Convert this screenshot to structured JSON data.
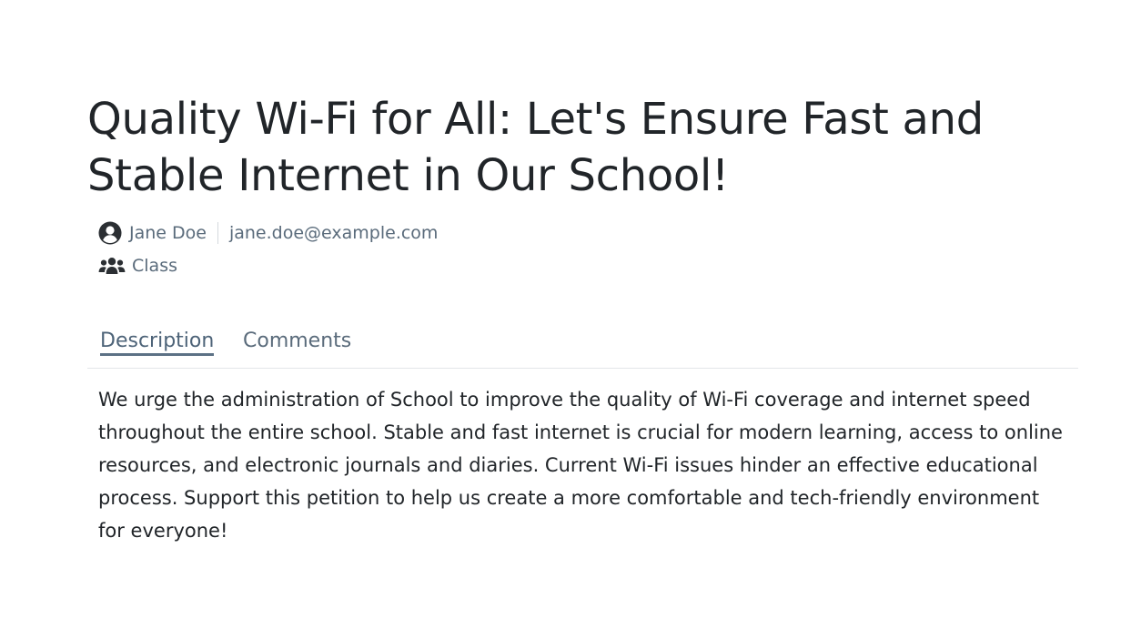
{
  "petition": {
    "title": "Quality Wi-Fi for All: Let's Ensure Fast and Stable Internet in Our School!",
    "author_name": "Jane Doe",
    "author_email": "jane.doe@example.com",
    "audience": "Class",
    "description": "We urge the administration of School to improve the quality of Wi-Fi coverage and internet speed throughout the entire school. Stable and fast internet is crucial for modern learning, access to online resources, and electronic journals and diaries. Current Wi-Fi issues hinder an effective educational process. Support this petition to help us create a more comfortable and tech-friendly environment for everyone!"
  },
  "tabs": {
    "description_label": "Description",
    "comments_label": "Comments",
    "active": "Description"
  },
  "icons": {
    "author": "user-circle-icon",
    "audience": "users-group-icon"
  },
  "colors": {
    "text": "#212529",
    "muted": "#5a6b7b",
    "active_tab": "#5c7185"
  }
}
